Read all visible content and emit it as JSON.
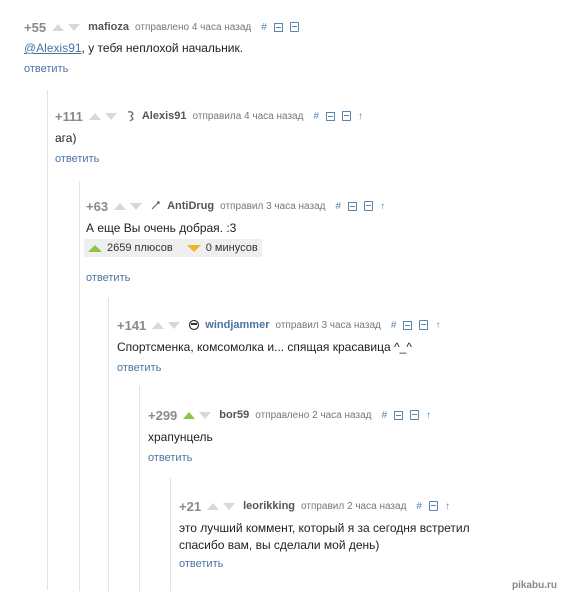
{
  "comments": [
    {
      "rating": "+55",
      "author": "mafioza",
      "time": "отправлено 4 часа назад",
      "text_pre": "",
      "text_link": "@Alexis91",
      "text_post": ", у тебя неплохой начальник.",
      "reply": "ответить"
    },
    {
      "rating": "+111",
      "author": "Alexis91",
      "time": "отправила 4 часа назад",
      "text": "ага)",
      "reply": "ответить"
    },
    {
      "rating": "+63",
      "author": "AntiDrug",
      "time": "отправил 3 часа назад",
      "text": "А еще Вы очень добрая. :3",
      "pluses": "2659 плюсов",
      "minuses": "0 минусов",
      "reply": "ответить"
    },
    {
      "rating": "+141",
      "author": "windjammer",
      "time": "отправил 3 часа назад",
      "text": "Спортсменка, комсомолка и... спящая красавица ^_^",
      "reply": "ответить"
    },
    {
      "rating": "+299",
      "author": "bor59",
      "time": "отправлено 2 часа назад",
      "text": "храпунцель",
      "reply": "ответить"
    },
    {
      "rating": "+21",
      "author": "leorikking",
      "time": "отправил 2 часа назад",
      "text_line1": "это лучший коммент, который я за сегодня встретил",
      "text_line2": "спасибо вам, вы сделали мой день)",
      "reply": "ответить"
    }
  ],
  "tools": {
    "hash": "#",
    "up": "↑"
  },
  "watermark": "pikabu.ru",
  "colors": {
    "link": "#4d73a3",
    "upvote": "#8ec544",
    "downvote_badge": "#f0b429"
  }
}
